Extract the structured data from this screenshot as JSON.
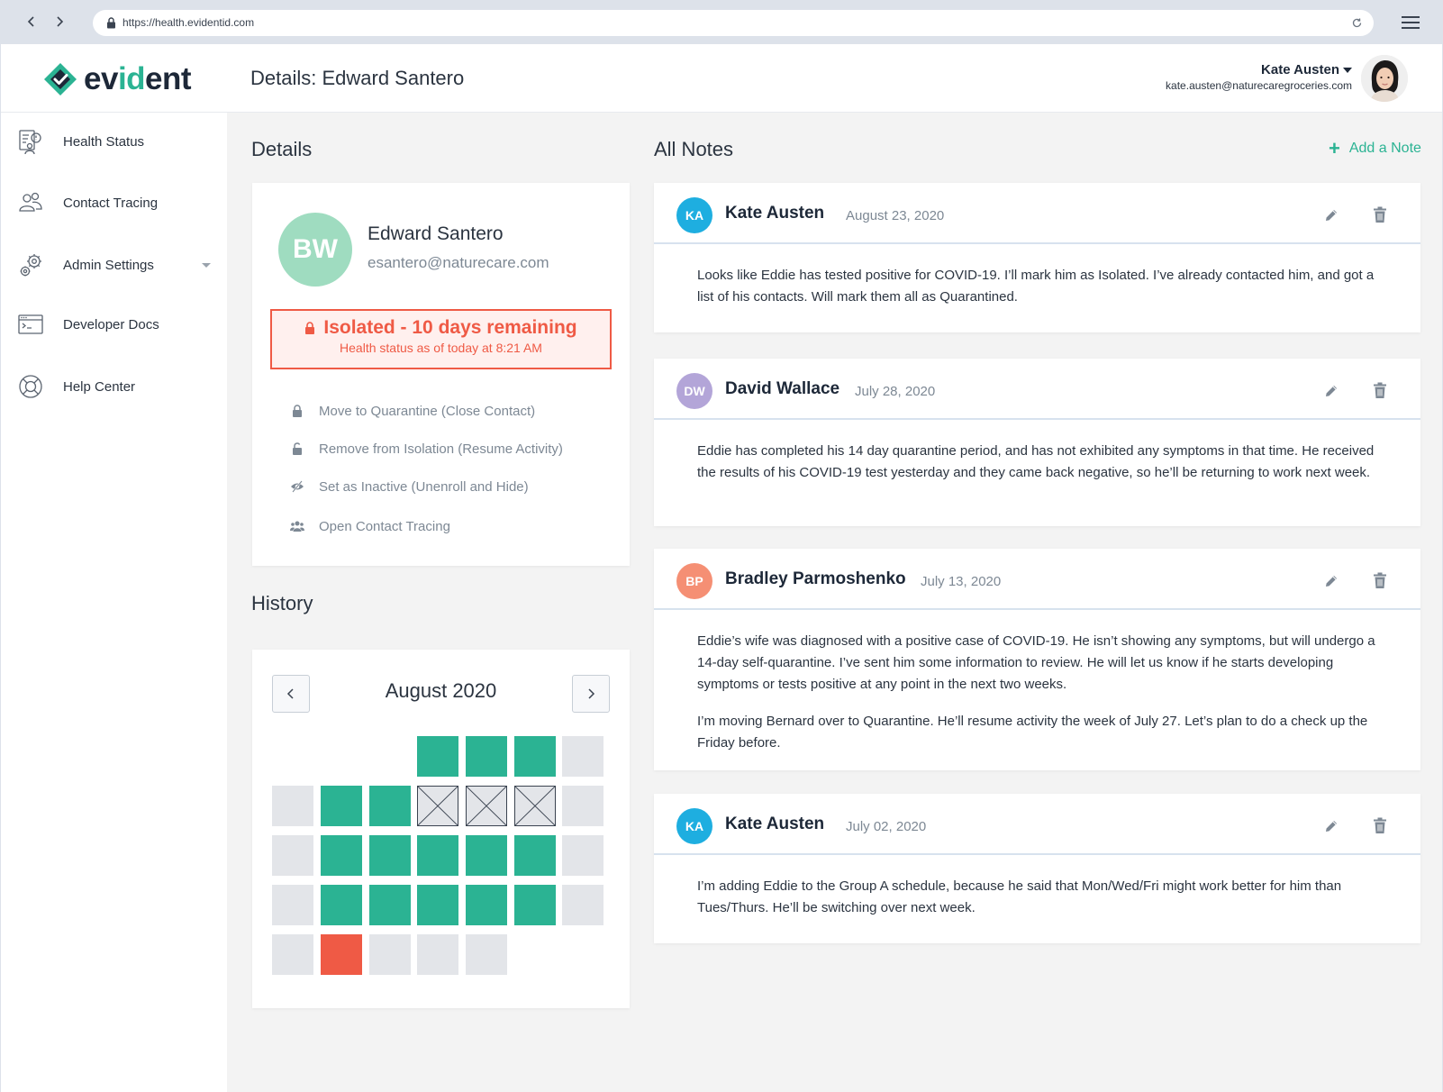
{
  "browser": {
    "url": "https://health.evidentid.com"
  },
  "header": {
    "logo_prefix": "ev",
    "logo_accent": "id",
    "logo_suffix": "ent",
    "page_title": "Details: Edward Santero",
    "user_name": "Kate Austen",
    "user_email": "kate.austen@naturecaregroceries.com"
  },
  "sidebar": {
    "items": [
      {
        "label": "Health Status",
        "icon": "health-status-icon"
      },
      {
        "label": "Contact Tracing",
        "icon": "contact-tracing-icon"
      },
      {
        "label": "Admin Settings",
        "icon": "admin-settings-icon"
      },
      {
        "label": "Developer Docs",
        "icon": "developer-docs-icon"
      },
      {
        "label": "Help Center",
        "icon": "help-center-icon"
      }
    ]
  },
  "details": {
    "section_title": "Details",
    "avatar_initials": "BW",
    "name": "Edward Santero",
    "email": "esantero@naturecare.com",
    "status_title": "Isolated - 10 days remaining",
    "status_subtitle": "Health status as of today at 8:21 AM",
    "actions": [
      {
        "label": "Move to Quarantine (Close Contact)",
        "icon": "lock-icon"
      },
      {
        "label": "Remove from Isolation (Resume Activity)",
        "icon": "unlock-icon"
      },
      {
        "label": "Set as Inactive (Unenroll and Hide)",
        "icon": "eye-slash-icon"
      },
      {
        "label": "Open Contact Tracing",
        "icon": "users-icon"
      }
    ]
  },
  "history": {
    "section_title": "History",
    "month_label": "August 2020",
    "weeks": [
      [
        "blank",
        "blank",
        "blank",
        "ok",
        "ok",
        "ok",
        "none"
      ],
      [
        "none",
        "ok",
        "ok",
        "x",
        "x",
        "x",
        "none"
      ],
      [
        "none",
        "ok",
        "ok",
        "ok",
        "ok",
        "ok",
        "none"
      ],
      [
        "none",
        "ok",
        "ok",
        "ok",
        "ok",
        "ok",
        "none"
      ],
      [
        "none",
        "bad",
        "none",
        "none",
        "none",
        "blank",
        "blank"
      ]
    ]
  },
  "notes": {
    "section_title": "All Notes",
    "add_label": "Add a Note",
    "items": [
      {
        "initials": "KA",
        "avatar_color": "#1eaee0",
        "author": "Kate Austen",
        "date": "August 23, 2020",
        "paragraphs": [
          "Looks like Eddie has tested positive for COVID-19. I’ll mark him as Isolated. I’ve already contacted him, and got a list of his contacts. Will mark them all as Quarantined."
        ]
      },
      {
        "initials": "DW",
        "avatar_color": "#b3a5d8",
        "author": "David Wallace",
        "date": "July 28, 2020",
        "paragraphs": [
          "Eddie has completed his 14 day quarantine period, and has not exhibited any symptoms in that time. He received the results of his COVID-19 test yesterday and they came back negative, so he’ll be returning to work next week."
        ]
      },
      {
        "initials": "BP",
        "avatar_color": "#f58f74",
        "author": "Bradley Parmoshenko",
        "date": "July 13, 2020",
        "paragraphs": [
          "Eddie’s wife was diagnosed with a positive case of COVID-19. He isn’t showing any symptoms, but will undergo a 14-day self-quarantine. I’ve sent him some information to review. He will let us know if he starts developing symptoms or tests positive at any point in the next two weeks.",
          "I’m moving Bernard over to Quarantine. He’ll resume activity the week of July 27. Let’s plan to do a check up the Friday before."
        ]
      },
      {
        "initials": "KA",
        "avatar_color": "#1eaee0",
        "author": "Kate Austen",
        "date": "July 02, 2020",
        "paragraphs": [
          "I’m adding Eddie to the Group A schedule, because he said that Mon/Wed/Fri might work better for him than Tues/Thurs. He’ll be switching over next week."
        ]
      }
    ]
  },
  "colors": {
    "brand": "#2bb393",
    "alert": "#ef5a45",
    "text_dark": "#1d2838",
    "text_muted": "#7d8894"
  }
}
